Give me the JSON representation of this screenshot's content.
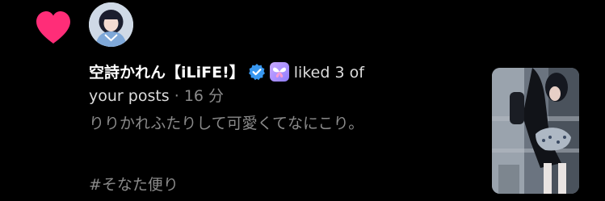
{
  "notification": {
    "icon": "heart-icon",
    "icon_color": "#ff2d78",
    "avatar": "user-avatar",
    "username": "空詩かれん【iLiFE!】",
    "verified_icon": "verified-badge-icon",
    "verified_color": "#3897f0",
    "badge_icon": "butterfly-badge-icon",
    "action_line1": "liked 3 of",
    "action_line2": "your posts",
    "separator": "·",
    "time": "16 分",
    "comment": "りりかれふたりして可愛くてなにこり。",
    "hashtag": "#そなた便り",
    "thumbnail": "post-thumbnail-image"
  }
}
